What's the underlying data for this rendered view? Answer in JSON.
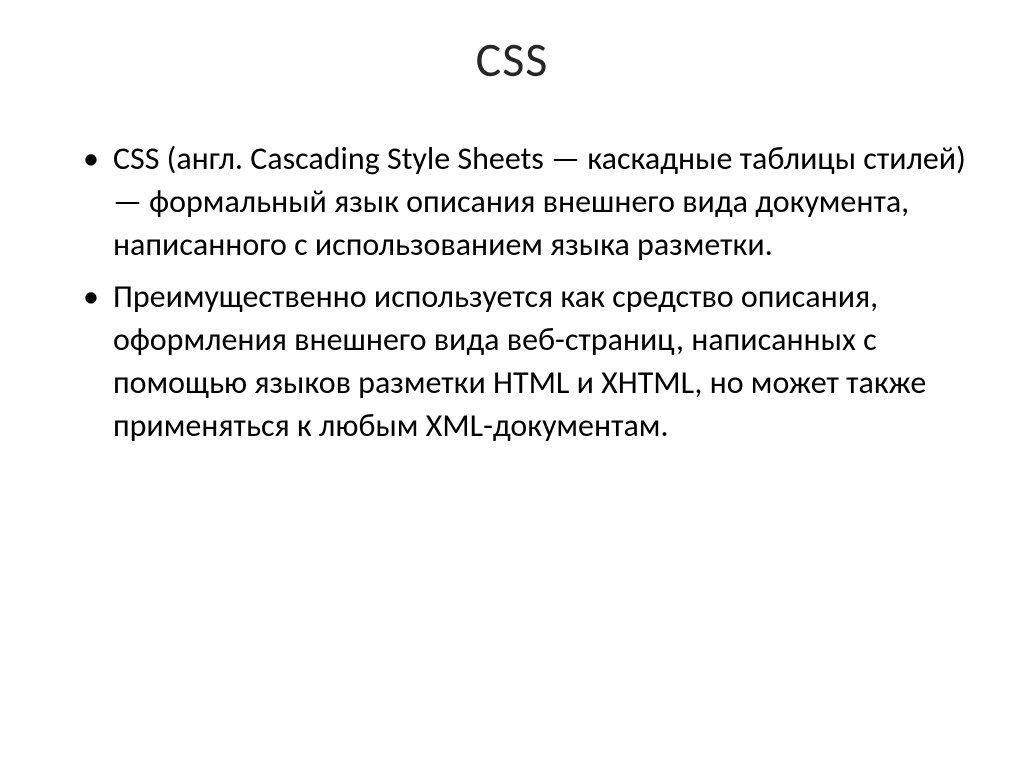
{
  "slide": {
    "title": "CSS",
    "bullets": [
      "CSS (англ. Cascading Style Sheets — каскадные таблицы стилей) — формальный язык описания внешнего вида документа, написанного с использованием языка разметки.",
      "Преимущественно используется как средство описания, оформления внешнего вида веб-страниц, написанных с помощью языков разметки HTML и XHTML, но может также применяться к любым XML-документам."
    ]
  }
}
